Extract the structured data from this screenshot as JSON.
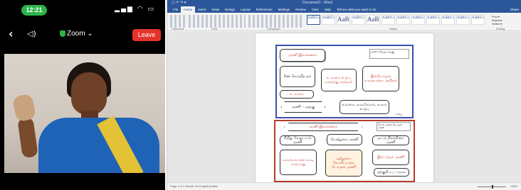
{
  "phone": {
    "time": "12:21",
    "status_icons": "▂▄▆ ◠ ▭",
    "zoom_label": "Zoom ⌄",
    "leave_label": "Leave",
    "back_glyph": "‹",
    "speaker_glyph": "◁)"
  },
  "word": {
    "title": "Document1 - Word",
    "qat": "▢ ↶ ↷ ▾",
    "tabs": [
      "File",
      "Home",
      "Insert",
      "Draw",
      "Design",
      "Layout",
      "References",
      "Mailings",
      "Review",
      "View",
      "Help",
      "Tell me what you want to do",
      "Share"
    ],
    "ribbon_groups": [
      "Clipboard",
      "Font",
      "Paragraph",
      "Styles",
      "Editing"
    ],
    "styles": [
      "AaBbCcDc",
      "AaBbCcDc",
      "AaBbC",
      "AaBbCc",
      "AaBC",
      "AaBbCcD",
      "AaBbCcDc",
      "AaBbCcDc",
      "AaBbCcDc",
      "AaBbCcDc",
      "AaBbCcDc",
      "AaBbCcDc"
    ],
    "editing": [
      "Find ▾",
      "Replace",
      "Select ▾"
    ],
    "status_left": "Page 1 of 1   Words: 54   English (India)",
    "status_right": "100%",
    "diagram": {
      "top_title": "அணி இலக்கணம்",
      "top_note": "அணி என்பது அழகு",
      "box_a": "நீண் மொழித் தல்",
      "box_b": "உ வமை உருபு மறைந்து வந்தால்",
      "box_c": "இல்பொருள் உவமையை அறிதல்",
      "box_d": "உ வமை",
      "box_e": "அணி – அழகு",
      "box_f": "உவமை, உவமேயம், உவம உருபு",
      "bottom_title": "அணி இலக்கணம்",
      "bottom_note": "சொல் அணி பொருள் அணி",
      "box_g": "சிறிது வேறுபட்டு அணி",
      "box_h": "வேற்றுமை அணி",
      "box_i": "ஒட்டு நிரல்நிறை அணி",
      "box_j": "உவமையாகச் சுட்டி வருமாறு",
      "box_k": "ஒற்றுமை வெளிப்படும் பொருள் அணி",
      "box_l": "இரட்டுறல் அணி",
      "box_m": "தற்குறிப்பு – நயம்",
      "signature": "சான்று"
    }
  }
}
